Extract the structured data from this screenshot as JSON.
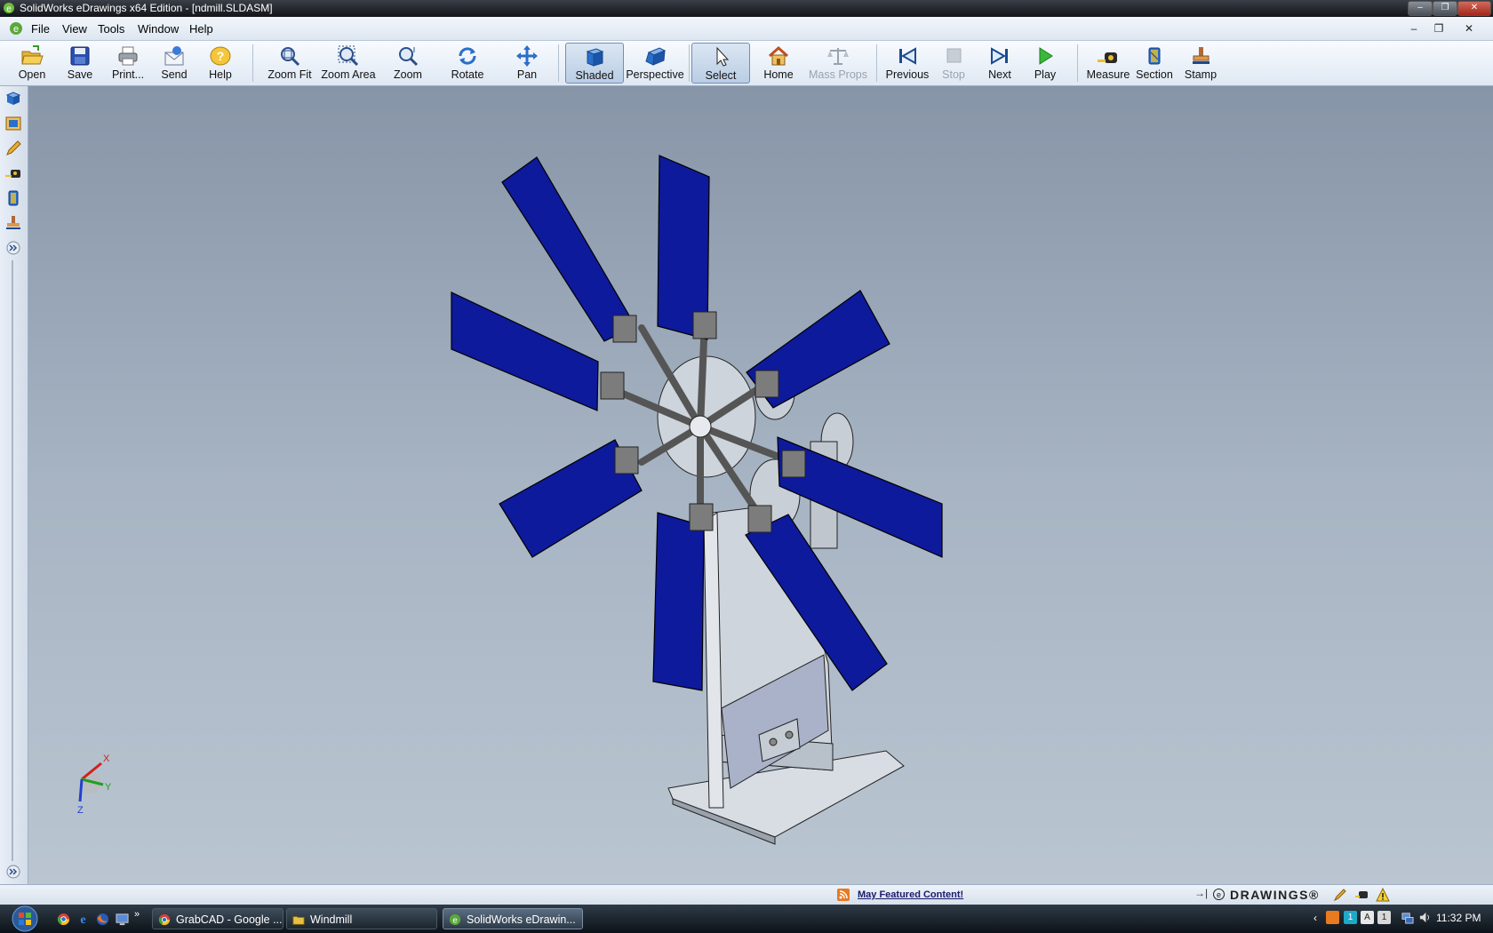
{
  "window": {
    "title": "SolidWorks eDrawings x64 Edition - [ndmill.SLDASM]"
  },
  "menu": {
    "items": [
      "File",
      "View",
      "Tools",
      "Window",
      "Help"
    ]
  },
  "toolbar": {
    "open": "Open",
    "save": "Save",
    "print": "Print...",
    "send": "Send",
    "help": "Help",
    "zoom_fit": "Zoom Fit",
    "zoom_area": "Zoom Area",
    "zoom": "Zoom",
    "rotate": "Rotate",
    "pan": "Pan",
    "shaded": "Shaded",
    "perspective": "Perspective",
    "select": "Select",
    "home": "Home",
    "mass_props": "Mass Props",
    "previous": "Previous",
    "stop": "Stop",
    "next": "Next",
    "play": "Play",
    "measure": "Measure",
    "section": "Section",
    "stamp": "Stamp"
  },
  "triad": {
    "x": "X",
    "y": "Y",
    "z": "Z"
  },
  "status": {
    "featured": "May Featured Content!",
    "brand": "DRAWINGS®"
  },
  "taskbar": {
    "items": [
      "GrabCAD - Google ...",
      "Windmill",
      "SolidWorks eDrawin..."
    ],
    "clock": "11:32 PM",
    "tray_letters": [
      "1",
      "A",
      "1"
    ]
  },
  "colors": {
    "blade": "#0d1a9c",
    "viewport_top": "#8795a8",
    "viewport_bottom": "#bac5d1",
    "accent": "#2a6fc9"
  }
}
